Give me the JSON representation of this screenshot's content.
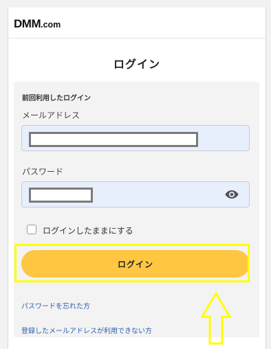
{
  "header": {
    "logo_main": "DMM",
    "logo_suffix": ".com"
  },
  "page": {
    "title": "ログイン"
  },
  "form": {
    "previous_login_label": "前回利用したログイン",
    "email_label": "メールアドレス",
    "email_value": "",
    "password_label": "パスワード",
    "password_value": "",
    "show_password_icon": "eye-icon",
    "remember_label": "ログインしたままにする",
    "remember_checked": false,
    "submit_label": "ログイン",
    "forgot_password_link": "パスワードを忘れた方",
    "email_unusable_link": "登録したメールアドレスが利用できない方"
  },
  "colors": {
    "button": "#ffc641",
    "input_bg": "#e8effc",
    "link": "#2a5db0",
    "highlight": "#ffff00"
  }
}
